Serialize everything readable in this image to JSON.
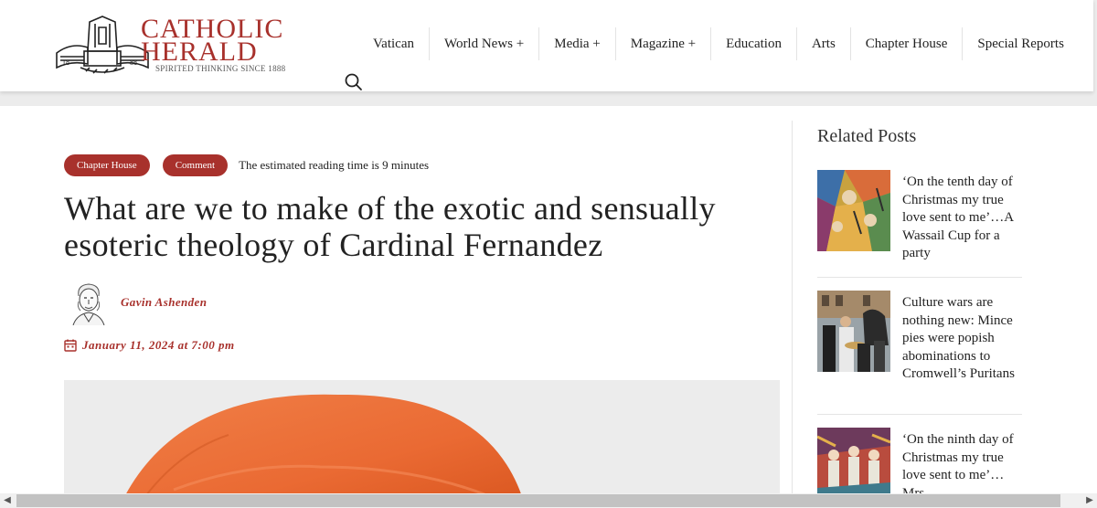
{
  "logo": {
    "line1": "CATHOLIC",
    "line2": "HERALD",
    "tagline": "SPIRITED THINKING SINCE 1888",
    "year_left": "18",
    "year_right": "88"
  },
  "nav": {
    "items": [
      "Vatican",
      "World News +",
      "Media +",
      "Magazine +",
      "Education",
      "Arts",
      "Chapter House",
      "Special Reports"
    ]
  },
  "search": {
    "icon": "search-icon"
  },
  "article": {
    "categories": [
      "Chapter House",
      "Comment"
    ],
    "reading_time": "The estimated reading time is 9 minutes",
    "title": "What are we to make of the exotic and sensually esoteric theology of Cardinal Fernandez",
    "author": "Gavin Ashenden",
    "date": "January 11, 2024 at 7:00 pm",
    "date_icon": "calendar-icon"
  },
  "sidebar": {
    "heading": "Related Posts",
    "posts": [
      {
        "title": "‘On the tenth day of Christmas my true love sent to me’…A Wassail Cup for a party"
      },
      {
        "title": "Culture wars are nothing new: Mince pies were popish abominations to Cromwell’s Puritans"
      },
      {
        "title": "‘On the ninth day of Christmas my true love sent to me’…Mrs"
      }
    ]
  },
  "colors": {
    "accent": "#a8312c",
    "text": "#222222",
    "background": "#ececec"
  },
  "scrollbar": {
    "left_arrow": "◀",
    "right_arrow": "▶"
  }
}
